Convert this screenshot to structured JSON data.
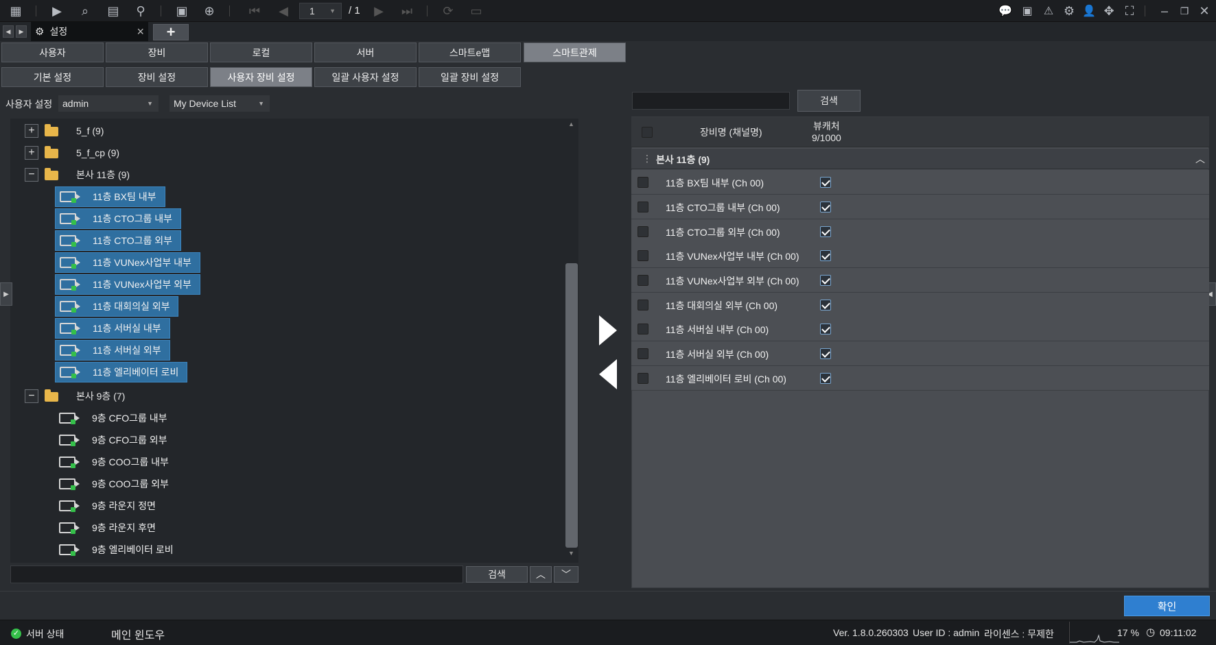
{
  "toolbar": {
    "page_current": "1",
    "page_total": "/ 1",
    "icons_left": [
      "grid-icon",
      "play-icon",
      "search-playback-icon",
      "export-icon",
      "event-search-icon",
      "layout-icon",
      "add-monitor-icon"
    ],
    "icons_right": [
      "chat-icon",
      "notification-icon",
      "alarm-icon",
      "settings-icon",
      "user-icon",
      "move-icon",
      "fullscreen-icon",
      "minimize-icon",
      "restore-icon",
      "close-icon"
    ]
  },
  "doc_tab": {
    "label": "설정"
  },
  "main_tabs": [
    "사용자",
    "장비",
    "로컬",
    "서버",
    "스마트e맵",
    "스마트관제"
  ],
  "sub_tabs": [
    "기본 설정",
    "장비 설정",
    "사용자 장비 설정",
    "일괄 사용자 설정",
    "일괄 장비 설정"
  ],
  "left": {
    "user_label": "사용자 설정",
    "user_value": "admin",
    "list_value": "My Device List",
    "search_button": "검색",
    "search_value": "",
    "tree": {
      "folders": [
        {
          "name": "5_f (9)",
          "expander": "+"
        },
        {
          "name": "5_f_cp (9)",
          "expander": "+"
        },
        {
          "name": "본사 11층 (9)",
          "expander": "−"
        },
        {
          "name": "본사 9층 (7)",
          "expander": "−"
        }
      ],
      "selected_devices": [
        "11층 BX팀 내부",
        "11층 CTO그룹 내부",
        "11층 CTO그룹 외부",
        "11층 VUNex사업부 내부",
        "11층 VUNex사업부 외부",
        "11층 대회의실 외부",
        "11층 서버실 내부",
        "11층 서버실 외부",
        "11층 엘리베이터 로비"
      ],
      "devices_9f": [
        "9층 CFO그룹 내부",
        "9층 CFO그룹 외부",
        "9층 COO그룹 내부",
        "9층 COO그룹 외부",
        "9층 라운지 정면",
        "9층 라운지 후면",
        "9층 엘리베이터 로비"
      ]
    }
  },
  "right": {
    "search_button": "검색",
    "search_value": "",
    "col_device": "장비명 (채널명)",
    "col_viewer": "뷰캐처",
    "col_viewer_count": "9/1000",
    "group": "본사 11층 (9)",
    "rows": [
      {
        "name": "11층 BX팀 내부 (Ch 00)",
        "checked": true
      },
      {
        "name": "11층 CTO그룹 내부 (Ch 00)",
        "checked": true
      },
      {
        "name": "11층 CTO그룹 외부 (Ch 00)",
        "checked": true
      },
      {
        "name": "11층 VUNex사업부 내부 (Ch 00)",
        "checked": true
      },
      {
        "name": "11층 VUNex사업부 외부 (Ch 00)",
        "checked": true
      },
      {
        "name": "11층 대회의실 외부 (Ch 00)",
        "checked": true
      },
      {
        "name": "11층 서버실 내부 (Ch 00)",
        "checked": true
      },
      {
        "name": "11층 서버실 외부 (Ch 00)",
        "checked": true
      },
      {
        "name": "11층 엘리베이터 로비 (Ch 00)",
        "checked": true
      }
    ]
  },
  "confirm_button": "확인",
  "status": {
    "server_status": "서버 상태",
    "main_window": "메인 윈도우",
    "version": "Ver. 1.8.0.260303",
    "user_id": "User ID : admin",
    "license": "라이센스 : 무제한",
    "cpu": "17 %",
    "time": "09:11:02"
  },
  "colors": {
    "selected": "#2f6fa0",
    "accent_button": "#2f7fd0",
    "folder": "#e8b64a",
    "status_ok": "#35c04a"
  }
}
